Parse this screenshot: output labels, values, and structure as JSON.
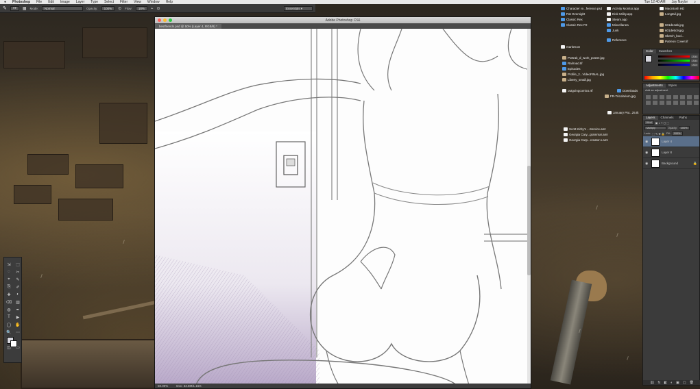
{
  "menubar": {
    "app": "Photoshop",
    "items": [
      "File",
      "Edit",
      "Image",
      "Layer",
      "Type",
      "Select",
      "Filter",
      "View",
      "Window",
      "Help"
    ],
    "clock": "Tue 12:40 AM",
    "user": "Jay Naylor"
  },
  "options": {
    "mode_label": "Mode:",
    "mode_value": "Normal",
    "opacity_label": "Opacity:",
    "opacity_value": "100%",
    "flow_label": "Flow:",
    "flow_value": "18%",
    "workspace": "Essentials"
  },
  "tools": [
    "⇲",
    "⬚",
    "◌",
    "✂",
    "⌖",
    "✎",
    "⎘",
    "✐",
    "✚",
    "◐",
    "⌫",
    "▥",
    "◍",
    "✒",
    "T",
    "▶",
    "◯",
    "✋",
    "🔍",
    "⋯"
  ],
  "document": {
    "window_title": "Adobe Photoshop CS6",
    "tab_label": "bestfriends.psd @ 50% (Layer 4, RGB/8) *",
    "zoom": "50.00%",
    "doc_info": "Doc: 33.8M/1.16G"
  },
  "desktop_files": [
    {
      "label": "Character re...ference.psd",
      "kind": "folder"
    },
    {
      "label": "Pat Oversight",
      "kind": "folder"
    },
    {
      "label": "Classic Rex",
      "kind": "folder"
    },
    {
      "label": "Classic Rex P2",
      "kind": "folder"
    },
    {
      "label": "Activity Monitor.app",
      "kind": "doc"
    },
    {
      "label": "Disk Utility.app",
      "kind": "doc"
    },
    {
      "label": "Steam.app",
      "kind": "doc"
    },
    {
      "label": "Miscellanea",
      "kind": "folder"
    },
    {
      "label": "Junk",
      "kind": "folder"
    },
    {
      "label": "Macintosh HD",
      "kind": "doc"
    },
    {
      "label": "Longtail.jpg",
      "kind": "img"
    },
    {
      "label": "601de4ab.jpg",
      "kind": "img"
    },
    {
      "label": "601de5c9.jpg",
      "kind": "img"
    },
    {
      "label": "Sketch_bod...",
      "kind": "img"
    },
    {
      "label": "Patreon Cover.tif",
      "kind": "img"
    },
    {
      "label": "Reference",
      "kind": "folder"
    },
    {
      "label": "market.txt",
      "kind": "doc"
    },
    {
      "label": "Portrait_d_work_poster.jpg",
      "kind": "img"
    },
    {
      "label": "Railroad.tif",
      "kind": "folder"
    },
    {
      "label": "Episodes",
      "kind": "folder"
    },
    {
      "label": "Profile_2...VideoFINAL.jpg",
      "kind": "img"
    },
    {
      "label": "Liberty_small.jpg",
      "kind": "img"
    },
    {
      "label": "outgoingcomics.rtf",
      "kind": "doc"
    },
    {
      "label": "Downloads",
      "kind": "folder"
    },
    {
      "label": "FR-Tricolarium.jpg",
      "kind": "img"
    },
    {
      "label": "January Pat...25.tk",
      "kind": "doc"
    },
    {
      "label": "Scott Kirby's ...Service.amr",
      "kind": "doc"
    },
    {
      "label": "Georgia Cary...grammar.amr",
      "kind": "doc"
    },
    {
      "label": "Georgia Carp...creator.s.amr",
      "kind": "doc"
    }
  ],
  "color_panel": {
    "tabs": [
      "Color",
      "Swatches"
    ],
    "r": "216",
    "g": "216",
    "b": "223"
  },
  "adjust_panel": {
    "tabs": [
      "Adjustments",
      "Styles"
    ],
    "hint": "Add an adjustment"
  },
  "layers_panel": {
    "tabs": [
      "Layers",
      "Channels",
      "Paths"
    ],
    "kind_filter": "Kind",
    "blend_mode": "Multiply",
    "opacity_label": "Opacity:",
    "opacity_value": "100%",
    "lock_label": "Lock:",
    "fill_label": "Fill:",
    "fill_value": "100%",
    "layers": [
      {
        "name": "Layer 4",
        "visible": "◉",
        "selected": true
      },
      {
        "name": "Layer 8",
        "visible": "◉",
        "selected": false
      },
      {
        "name": "Background",
        "visible": "◉",
        "selected": false
      }
    ],
    "footer": [
      "⛓",
      "fx",
      "◧",
      "◐",
      "▣",
      "▢",
      "🗑"
    ]
  },
  "colors": {
    "accent": "#5a6f8a",
    "close": "#ff5f57",
    "min": "#febc2e",
    "max": "#28c840"
  }
}
